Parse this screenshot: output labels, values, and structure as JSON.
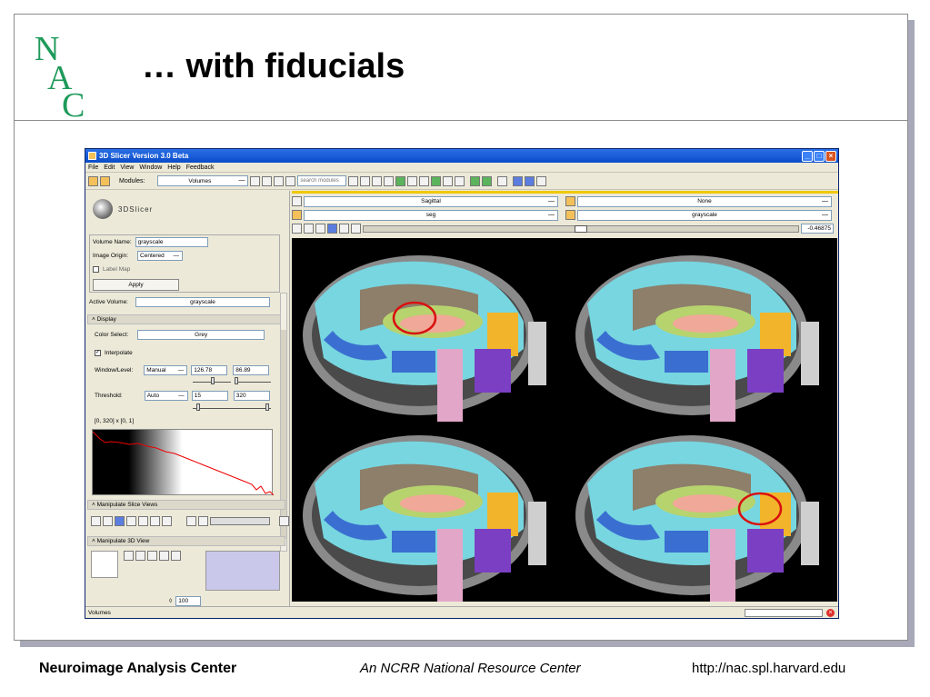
{
  "slide": {
    "title": "… with fiducials",
    "footer_left": "Neuroimage Analysis Center",
    "footer_mid": "An NCRR National Resource Center",
    "footer_right": "http://nac.spl.harvard.edu",
    "logo_letters": "NAC",
    "colors": {
      "logo_green": "#1e9a5a",
      "window_title_blue": "#0a4cc9"
    }
  },
  "app": {
    "title": "3D Slicer Version 3.0 Beta",
    "menu": [
      "File",
      "Edit",
      "View",
      "Window",
      "Help",
      "Feedback"
    ],
    "toolbar": {
      "modules_label": "Modules:",
      "module_value": "Volumes",
      "search_placeholder": "search modules"
    },
    "logo_text": "3DSlicer",
    "volume": {
      "name_label": "Volume Name:",
      "name_value": "grayscale",
      "origin_label": "Image Origin:",
      "origin_value": "Centered",
      "labelmap_label": "Label Map",
      "apply_label": "Apply"
    },
    "active_volume": {
      "label": "Active Volume:",
      "value": "grayscale"
    },
    "display": {
      "header": "Display",
      "color_label": "Color Select:",
      "color_value": "Grey",
      "interpolate_label": "Interpolate",
      "wl_label": "Window/Level:",
      "wl_mode": "Manual",
      "window": "126.78",
      "level": "86.89",
      "threshold_label": "Threshold:",
      "threshold_mode": "Auto",
      "thr_low": "15",
      "thr_high": "320",
      "hist_range": "[0, 320] x [0, 1]"
    },
    "manip_slice_header": "Manipulate Slice Views",
    "manip_3d_header": "Manipulate 3D View",
    "spin_value": "100",
    "views": {
      "orientation": "Sagittal",
      "fg": "seg",
      "right_fg": "None",
      "right_bg": "grayscale",
      "offset": "-0.46875"
    },
    "status": "Volumes"
  }
}
